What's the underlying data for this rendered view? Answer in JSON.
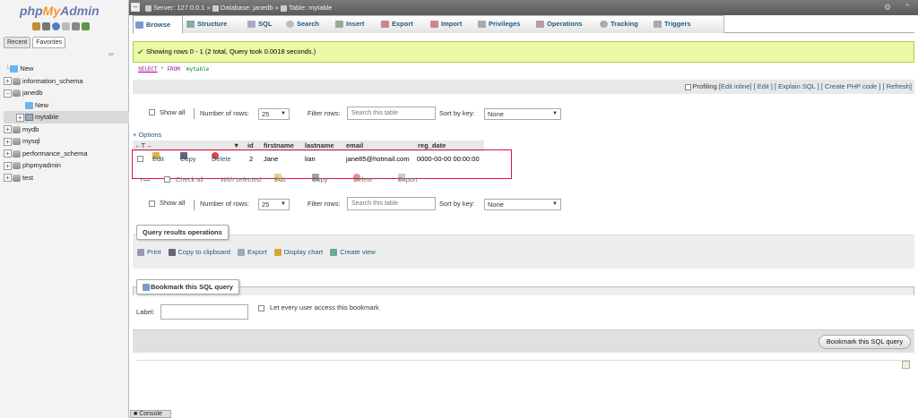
{
  "logo": {
    "php": "php",
    "my": "My",
    "admin": "Admin"
  },
  "left_tabs": [
    "Recent",
    "Favorites"
  ],
  "tree": [
    {
      "label": "New",
      "level": 0,
      "icon": "new"
    },
    {
      "label": "information_schema",
      "level": 0,
      "icon": "db"
    },
    {
      "label": "janedb",
      "level": 0,
      "icon": "db"
    },
    {
      "label": "New",
      "level": 1,
      "icon": "new"
    },
    {
      "label": "mytable",
      "level": 1,
      "icon": "table",
      "selected": true
    },
    {
      "label": "mydb",
      "level": 0,
      "icon": "db"
    },
    {
      "label": "mysql",
      "level": 0,
      "icon": "db"
    },
    {
      "label": "performance_schema",
      "level": 0,
      "icon": "db"
    },
    {
      "label": "phpmyadmin",
      "level": 0,
      "icon": "db"
    },
    {
      "label": "test",
      "level": 0,
      "icon": "db"
    }
  ],
  "breadcrumb": {
    "server": "Server: 127.0.0.1",
    "database": "Database: janedb",
    "table": "Table: mytable"
  },
  "menu": [
    {
      "label": "Browse",
      "icon": "browse-icon",
      "active": true
    },
    {
      "label": "Structure",
      "icon": "structure-icon"
    },
    {
      "label": "SQL",
      "icon": "sql-icon"
    },
    {
      "label": "Search",
      "icon": "search-icon"
    },
    {
      "label": "Insert",
      "icon": "insert-icon"
    },
    {
      "label": "Export",
      "icon": "export-icon"
    },
    {
      "label": "Import",
      "icon": "import-icon"
    },
    {
      "label": "Privileges",
      "icon": "privileges-icon"
    },
    {
      "label": "Operations",
      "icon": "operations-icon"
    },
    {
      "label": "Tracking",
      "icon": "tracking-icon"
    },
    {
      "label": "Triggers",
      "icon": "triggers-icon"
    }
  ],
  "message": "Showing rows 0 - 1 (2 total, Query took 0.0018 seconds.)",
  "sql": {
    "select": "SELECT",
    "star": "*",
    "from": "FROM",
    "table": "`mytable`"
  },
  "profiling": {
    "label": "Profiling",
    "links": [
      "[Edit inline]",
      "[ Edit ]",
      "[ Explain SQL ]",
      "[ Create PHP code ]",
      "[ Refresh]"
    ]
  },
  "nav": {
    "show_all": "Show all",
    "num_rows_label": "Number of rows:",
    "num_rows_value": "25",
    "filter_label": "Filter rows:",
    "filter_placeholder": "Search this table",
    "sort_label": "Sort by key:",
    "sort_value": "None"
  },
  "options_link": "+ Options",
  "columns": [
    "id",
    "firstname",
    "lastname",
    "email",
    "reg_date"
  ],
  "rows": [
    {
      "id": "2",
      "firstname": "Jane",
      "lastname": "lian",
      "email": "jane85@hotmail.com",
      "reg_date": "0000-00-00 00:00:00"
    }
  ],
  "row_actions": {
    "edit": "Edit",
    "copy": "Copy",
    "delete": "Delete"
  },
  "with_selected": {
    "check_all": "Check all",
    "label": "With selected:",
    "edit": "Edit",
    "copy": "Copy",
    "delete": "Delete",
    "export": "Export"
  },
  "query_ops": {
    "legend": "Query results operations",
    "links": [
      "Print",
      "Copy to clipboard",
      "Export",
      "Display chart",
      "Create view"
    ]
  },
  "bookmark": {
    "legend": "Bookmark this SQL query",
    "label": "Label:",
    "public_label": "Let every user access this bookmark",
    "button": "Bookmark this SQL query"
  },
  "console_label": "Console"
}
